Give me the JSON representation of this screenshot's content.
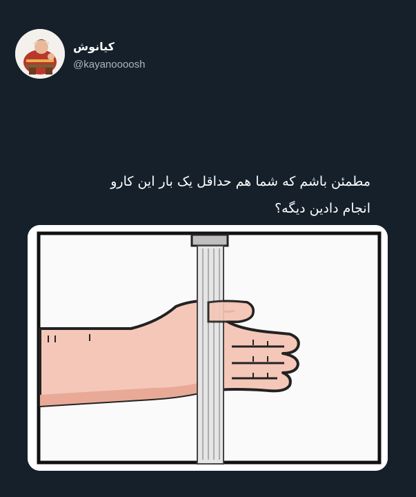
{
  "tweet": {
    "author": {
      "display_name": "کیانوش",
      "handle": "@kayanoooosh",
      "avatar_icon": "cartoon-character-avatar"
    },
    "text_line_1": "مطمئن باشم که شما هم حداقل یک بار این کارو",
    "text_line_2": "انجام دادین دیگه؟",
    "media": {
      "icon": "hand-under-running-water-illustration"
    }
  },
  "colors": {
    "background": "#15202b",
    "text_primary": "#ffffff",
    "text_secondary": "#aab8c2",
    "skin": "#f2c2b4",
    "water": "#e5e5e5"
  }
}
